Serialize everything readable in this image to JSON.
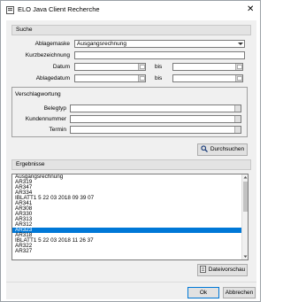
{
  "window": {
    "title": "ELO Java Client Recherche",
    "close_glyph": "✕"
  },
  "search_section": {
    "header": "Suche",
    "ablagemaske_label": "Ablagemaske",
    "ablagemaske_value": "Ausgangsrechnung",
    "kurzbezeichnung_label": "Kurzbezeichnung",
    "kurzbezeichnung_value": "",
    "datum_label": "Datum",
    "datum_from": "",
    "datum_bis_label": "bis",
    "datum_to": "",
    "ablagedatum_label": "Ablagedatum",
    "ablagedatum_from": "",
    "ablagedatum_bis_label": "bis",
    "ablagedatum_to": "",
    "verschlagwortung": {
      "title": "Verschlagwortung",
      "fields": [
        {
          "label": "Belegtyp",
          "value": ""
        },
        {
          "label": "Kundennummer",
          "value": ""
        },
        {
          "label": "Termin",
          "value": ""
        }
      ]
    },
    "search_button": "Durchsuchen"
  },
  "results_section": {
    "header": "Ergebnisse",
    "items": [
      "Ausgangsrechnung",
      "AR319",
      "AR347",
      "AR334",
      "IBLATT1  5 22 03 2018 09 39 07",
      "AR341",
      "AR308",
      "AR330",
      "AR313",
      "AR312",
      "AR323",
      "AR318",
      "IBLATT1  5 22 03 2018 11 26 37",
      "AR322",
      "AR327"
    ],
    "selected_index": 10,
    "preview_button": "Dateivorschau"
  },
  "footer": {
    "ok_button": "Ok",
    "cancel_button": "Abbrechen"
  },
  "colors": {
    "selection": "#0078d7",
    "background": "#f0f0f0"
  },
  "icons": {
    "app": "elo-app-icon",
    "search": "magnifier-icon",
    "preview": "document-preview-icon",
    "date": "calendar-icon"
  }
}
